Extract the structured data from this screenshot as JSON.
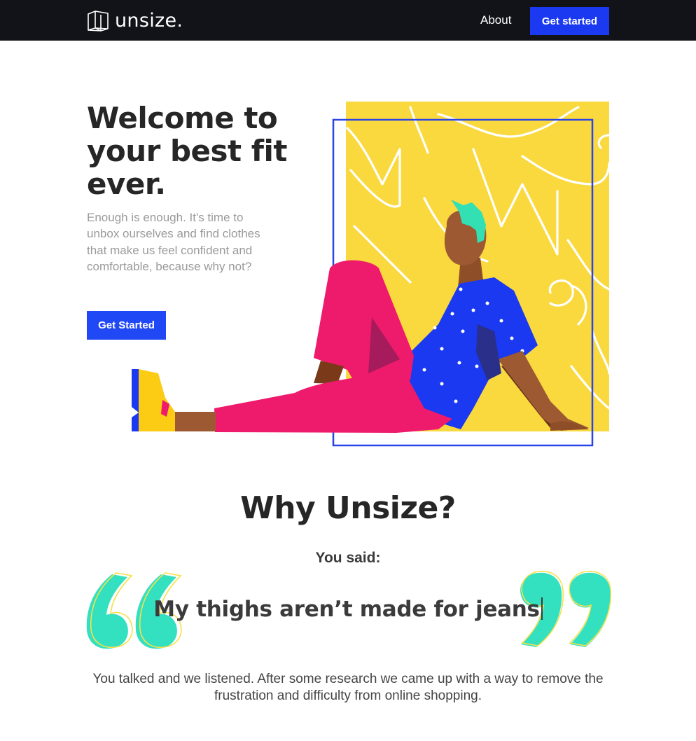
{
  "nav": {
    "logo_text": "unsize.",
    "about_label": "About",
    "cta_label": "Get started"
  },
  "hero": {
    "title": "Welcome to your best fit ever.",
    "subtitle": "Enough is enough. It's time to unbox ourselves and find clothes that make us feel confident and comfortable, because why not?",
    "cta_label": "Get Started"
  },
  "why": {
    "title": "Why Unsize?",
    "you_said": "You said:",
    "quote": "My thighs aren’t made for jeans",
    "description": "You talked and we listened. After some research we came up with a way to remove the frustration and difficulty from online shopping."
  },
  "colors": {
    "nav_bg": "#111318",
    "primary_blue": "#1a39f0",
    "illustration_yellow": "#fad93f",
    "quote_teal": "#33e0c0",
    "pants_pink": "#ee1a6b"
  },
  "icons": {
    "logo": "open-box-icon",
    "quote_open": "open-quote-icon",
    "quote_close": "close-quote-icon"
  }
}
